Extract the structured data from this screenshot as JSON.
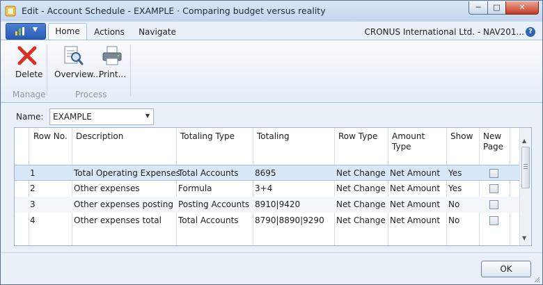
{
  "window": {
    "title": "Edit - Account Schedule - EXAMPLE · Comparing budget versus reality"
  },
  "ribbon": {
    "tabs": [
      "Home",
      "Actions",
      "Navigate"
    ],
    "company": "CRONUS International Ltd. - NAV201...",
    "buttons": [
      {
        "label": "Delete",
        "icon": "delete-x-icon"
      },
      {
        "label": "Overview...",
        "icon": "overview-document-magnifier-icon"
      },
      {
        "label": "Print...",
        "icon": "printer-icon"
      }
    ],
    "groups": [
      "Manage",
      "Process"
    ]
  },
  "name_field": {
    "label": "Name:",
    "value": "EXAMPLE"
  },
  "grid": {
    "columns": [
      "Row No.",
      "Description",
      "Totaling Type",
      "Totaling",
      "Row Type",
      "Amount Type",
      "Show",
      "New Page"
    ],
    "rows": [
      {
        "row_no": "1",
        "description": "Total Operating Expenses",
        "totaling_type": "Total Accounts",
        "totaling": "8695",
        "row_type": "Net Change",
        "amount_type": "Net Amount",
        "show": "Yes",
        "new_page": false
      },
      {
        "row_no": "2",
        "description": "Other expenses",
        "totaling_type": "Formula",
        "totaling": "3+4",
        "row_type": "Net Change",
        "amount_type": "Net Amount",
        "show": "Yes",
        "new_page": false
      },
      {
        "row_no": "3",
        "description": "Other expenses posting",
        "totaling_type": "Posting Accounts",
        "totaling": "8910|9420",
        "row_type": "Net Change",
        "amount_type": "Net Amount",
        "show": "No",
        "new_page": false
      },
      {
        "row_no": "4",
        "description": "Other expenses total",
        "totaling_type": "Total Accounts",
        "totaling": "8790|8890|9290",
        "row_type": "Net Change",
        "amount_type": "Net Amount",
        "show": "No",
        "new_page": false
      }
    ]
  },
  "footer": {
    "ok_label": "OK"
  },
  "colors": {
    "selected_row": "#d8e8f9",
    "accent": "#2a5bb4",
    "close_button": "#c53a22"
  }
}
